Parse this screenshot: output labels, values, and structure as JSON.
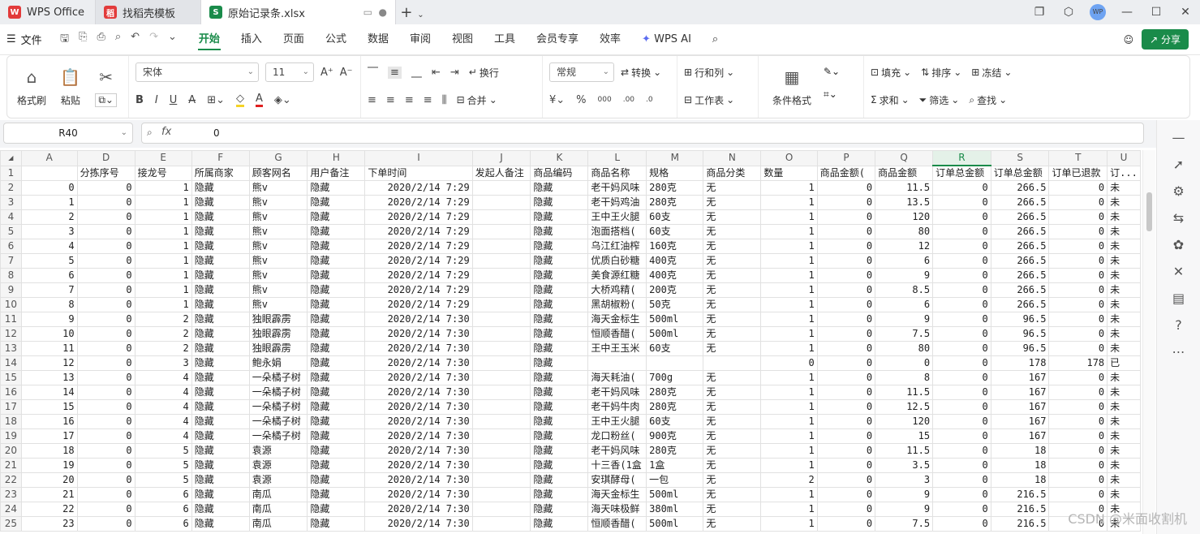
{
  "titlebar": {
    "tabs": [
      {
        "label": "WPS Office"
      },
      {
        "label": "找稻壳模板"
      },
      {
        "label": "原始记录条.xlsx"
      }
    ],
    "avatar_text": "WP"
  },
  "menubar": {
    "file_label": "文件",
    "tabs": [
      "开始",
      "插入",
      "页面",
      "公式",
      "数据",
      "审阅",
      "视图",
      "工具",
      "会员专享",
      "效率"
    ],
    "wps_ai": "WPS AI",
    "share": "分享"
  },
  "ribbon": {
    "format_painter": "格式刷",
    "paste": "粘贴",
    "font_name": "宋体",
    "font_size": "11",
    "wrap": "换行",
    "merge": "合并",
    "number_format": "常规",
    "convert": "转换",
    "rows_cols": "行和列",
    "worksheet": "工作表",
    "cond_format": "条件格式",
    "fill": "填充",
    "sort": "排序",
    "freeze": "冻结",
    "sum": "求和",
    "filter": "筛选",
    "find": "查找"
  },
  "formula_bar": {
    "name_box": "R40",
    "fx": "fx",
    "value": "0"
  },
  "columns": [
    "A",
    "D",
    "E",
    "F",
    "G",
    "H",
    "I",
    "J",
    "K",
    "L",
    "M",
    "N",
    "O",
    "P",
    "Q",
    "R",
    "S",
    "T",
    "U"
  ],
  "selected_column": "R",
  "header_row": [
    "",
    "分拣序号",
    "接龙号",
    "所属商家",
    "顾客网名",
    "用户备注",
    "下单时间",
    "发起人备注",
    "商品编码",
    "商品名称",
    "规格",
    "商品分类",
    "数量",
    "商品金额(",
    "商品金额",
    "订单总金额",
    "订单总金额",
    "订单已退款",
    "订..."
  ],
  "rows": [
    [
      "0",
      "0",
      "1",
      "隐藏",
      "熊v",
      "隐藏",
      "2020/2/14 7:29",
      "",
      "隐藏",
      "老干妈风味",
      "280克",
      "无",
      "1",
      "0",
      "11.5",
      "0",
      "266.5",
      "0",
      "未"
    ],
    [
      "1",
      "0",
      "1",
      "隐藏",
      "熊v",
      "隐藏",
      "2020/2/14 7:29",
      "",
      "隐藏",
      "老干妈鸡油",
      "280克",
      "无",
      "1",
      "0",
      "13.5",
      "0",
      "266.5",
      "0",
      "未"
    ],
    [
      "2",
      "0",
      "1",
      "隐藏",
      "熊v",
      "隐藏",
      "2020/2/14 7:29",
      "",
      "隐藏",
      "王中王火腿",
      "60支",
      "无",
      "1",
      "0",
      "120",
      "0",
      "266.5",
      "0",
      "未"
    ],
    [
      "3",
      "0",
      "1",
      "隐藏",
      "熊v",
      "隐藏",
      "2020/2/14 7:29",
      "",
      "隐藏",
      "泡面搭档(",
      "60支",
      "无",
      "1",
      "0",
      "80",
      "0",
      "266.5",
      "0",
      "未"
    ],
    [
      "4",
      "0",
      "1",
      "隐藏",
      "熊v",
      "隐藏",
      "2020/2/14 7:29",
      "",
      "隐藏",
      "乌江红油榨",
      "160克",
      "无",
      "1",
      "0",
      "12",
      "0",
      "266.5",
      "0",
      "未"
    ],
    [
      "5",
      "0",
      "1",
      "隐藏",
      "熊v",
      "隐藏",
      "2020/2/14 7:29",
      "",
      "隐藏",
      "优质白砂糖",
      "400克",
      "无",
      "1",
      "0",
      "6",
      "0",
      "266.5",
      "0",
      "未"
    ],
    [
      "6",
      "0",
      "1",
      "隐藏",
      "熊v",
      "隐藏",
      "2020/2/14 7:29",
      "",
      "隐藏",
      "美食源红糖",
      "400克",
      "无",
      "1",
      "0",
      "9",
      "0",
      "266.5",
      "0",
      "未"
    ],
    [
      "7",
      "0",
      "1",
      "隐藏",
      "熊v",
      "隐藏",
      "2020/2/14 7:29",
      "",
      "隐藏",
      "大桥鸡精(",
      "200克",
      "无",
      "1",
      "0",
      "8.5",
      "0",
      "266.5",
      "0",
      "未"
    ],
    [
      "8",
      "0",
      "1",
      "隐藏",
      "熊v",
      "隐藏",
      "2020/2/14 7:29",
      "",
      "隐藏",
      "黑胡椒粉(",
      "50克",
      "无",
      "1",
      "0",
      "6",
      "0",
      "266.5",
      "0",
      "未"
    ],
    [
      "9",
      "0",
      "2",
      "隐藏",
      "独眼霹雳",
      "隐藏",
      "2020/2/14 7:30",
      "",
      "隐藏",
      "海天金标生",
      "500ml",
      "无",
      "1",
      "0",
      "9",
      "0",
      "96.5",
      "0",
      "未"
    ],
    [
      "10",
      "0",
      "2",
      "隐藏",
      "独眼霹雳",
      "隐藏",
      "2020/2/14 7:30",
      "",
      "隐藏",
      "恒顺香醋(",
      "500ml",
      "无",
      "1",
      "0",
      "7.5",
      "0",
      "96.5",
      "0",
      "未"
    ],
    [
      "11",
      "0",
      "2",
      "隐藏",
      "独眼霹雳",
      "隐藏",
      "2020/2/14 7:30",
      "",
      "隐藏",
      "王中王玉米",
      "60支",
      "无",
      "1",
      "0",
      "80",
      "0",
      "96.5",
      "0",
      "未"
    ],
    [
      "12",
      "0",
      "3",
      "隐藏",
      "鲍永娟",
      "隐藏",
      "2020/2/14 7:30",
      "",
      "隐藏",
      "",
      "",
      "",
      "0",
      "0",
      "0",
      "0",
      "178",
      "178",
      "已"
    ],
    [
      "13",
      "0",
      "4",
      "隐藏",
      "一朵橘子树",
      "隐藏",
      "2020/2/14 7:30",
      "",
      "隐藏",
      "海天耗油(",
      "700g",
      "无",
      "1",
      "0",
      "8",
      "0",
      "167",
      "0",
      "未"
    ],
    [
      "14",
      "0",
      "4",
      "隐藏",
      "一朵橘子树",
      "隐藏",
      "2020/2/14 7:30",
      "",
      "隐藏",
      "老干妈风味",
      "280克",
      "无",
      "1",
      "0",
      "11.5",
      "0",
      "167",
      "0",
      "未"
    ],
    [
      "15",
      "0",
      "4",
      "隐藏",
      "一朵橘子树",
      "隐藏",
      "2020/2/14 7:30",
      "",
      "隐藏",
      "老干妈牛肉",
      "280克",
      "无",
      "1",
      "0",
      "12.5",
      "0",
      "167",
      "0",
      "未"
    ],
    [
      "16",
      "0",
      "4",
      "隐藏",
      "一朵橘子树",
      "隐藏",
      "2020/2/14 7:30",
      "",
      "隐藏",
      "王中王火腿",
      "60支",
      "无",
      "1",
      "0",
      "120",
      "0",
      "167",
      "0",
      "未"
    ],
    [
      "17",
      "0",
      "4",
      "隐藏",
      "一朵橘子树",
      "隐藏",
      "2020/2/14 7:30",
      "",
      "隐藏",
      "龙口粉丝(",
      "900克",
      "无",
      "1",
      "0",
      "15",
      "0",
      "167",
      "0",
      "未"
    ],
    [
      "18",
      "0",
      "5",
      "隐藏",
      "袁源",
      "隐藏",
      "2020/2/14 7:30",
      "",
      "隐藏",
      "老干妈风味",
      "280克",
      "无",
      "1",
      "0",
      "11.5",
      "0",
      "18",
      "0",
      "未"
    ],
    [
      "19",
      "0",
      "5",
      "隐藏",
      "袁源",
      "隐藏",
      "2020/2/14 7:30",
      "",
      "隐藏",
      "十三香(1盒",
      "1盒",
      "无",
      "1",
      "0",
      "3.5",
      "0",
      "18",
      "0",
      "未"
    ],
    [
      "20",
      "0",
      "5",
      "隐藏",
      "袁源",
      "隐藏",
      "2020/2/14 7:30",
      "",
      "隐藏",
      "安琪酵母(",
      "一包",
      "无",
      "2",
      "0",
      "3",
      "0",
      "18",
      "0",
      "未"
    ],
    [
      "21",
      "0",
      "6",
      "隐藏",
      "南瓜",
      "隐藏",
      "2020/2/14 7:30",
      "",
      "隐藏",
      "海天金标生",
      "500ml",
      "无",
      "1",
      "0",
      "9",
      "0",
      "216.5",
      "0",
      "未"
    ],
    [
      "22",
      "0",
      "6",
      "隐藏",
      "南瓜",
      "隐藏",
      "2020/2/14 7:30",
      "",
      "隐藏",
      "海天味极鲜",
      "380ml",
      "无",
      "1",
      "0",
      "9",
      "0",
      "216.5",
      "0",
      "未"
    ],
    [
      "23",
      "0",
      "6",
      "隐藏",
      "南瓜",
      "隐藏",
      "2020/2/14 7:30",
      "",
      "隐藏",
      "恒顺香醋(",
      "500ml",
      "无",
      "1",
      "0",
      "7.5",
      "0",
      "216.5",
      "0",
      "未"
    ]
  ],
  "watermark": "CSDN @米面收割机"
}
